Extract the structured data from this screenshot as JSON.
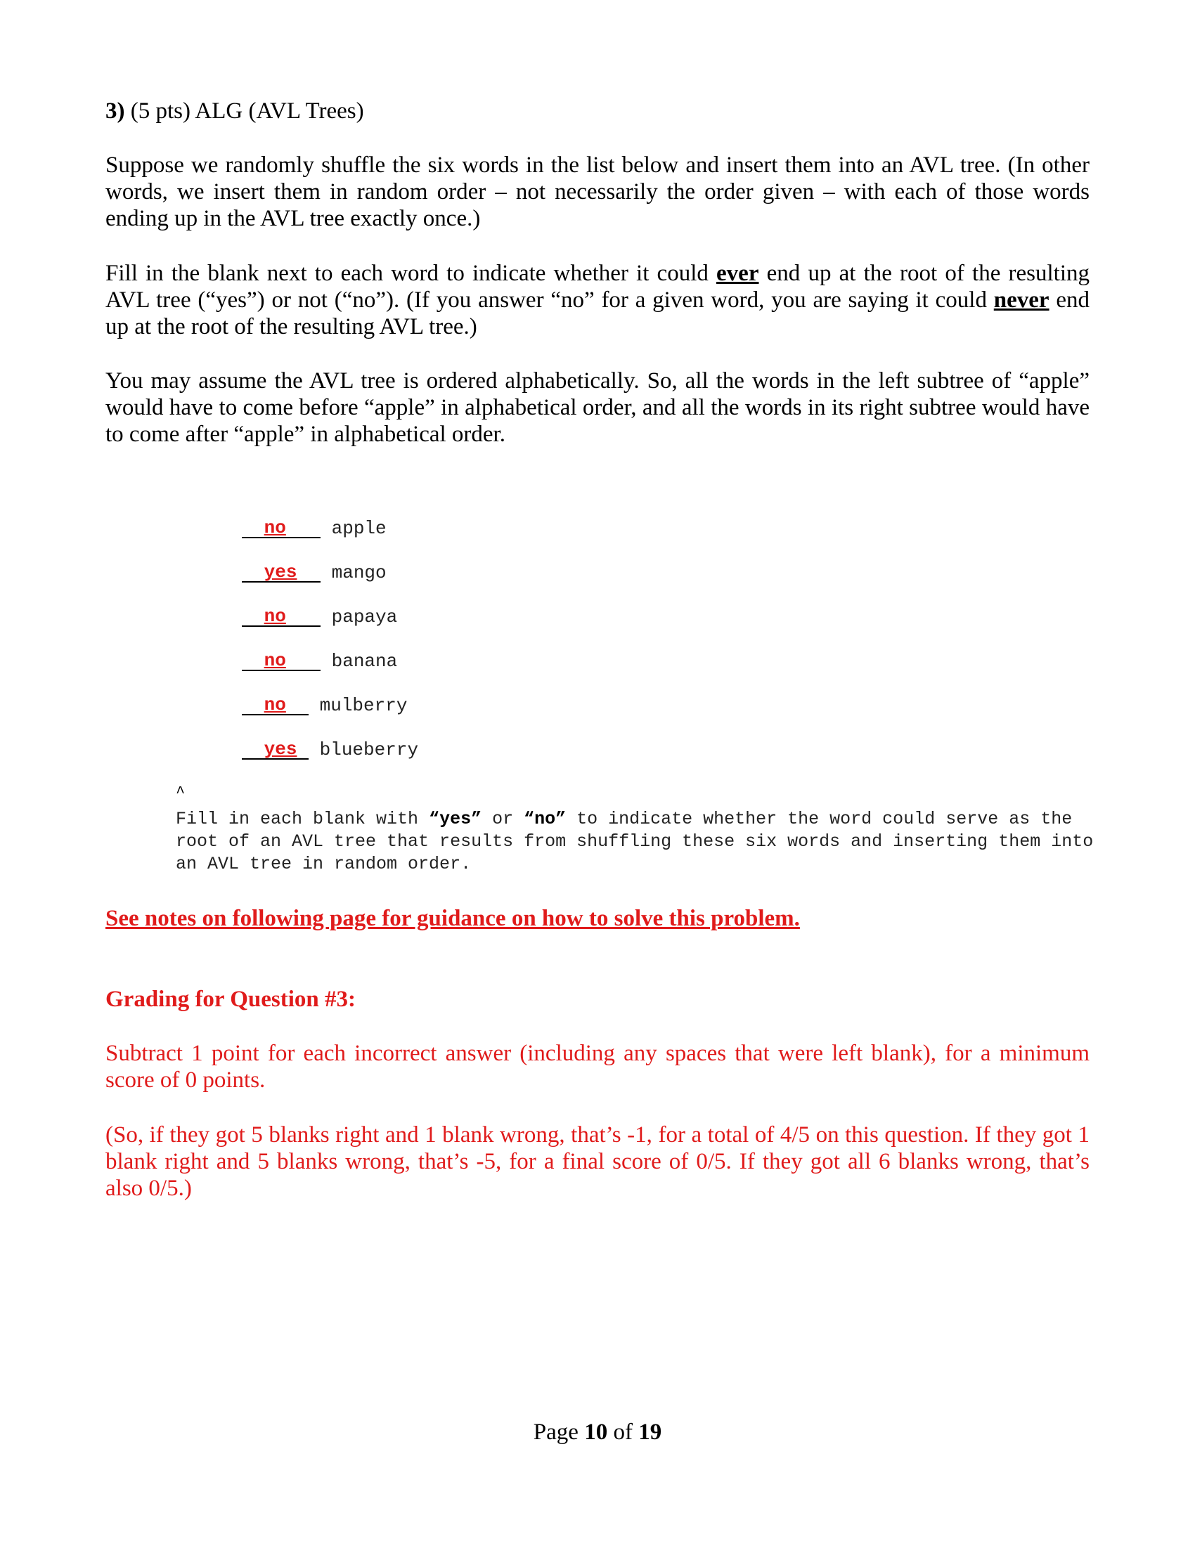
{
  "question": {
    "number": "3)",
    "points": "(5 pts) ALG (AVL Trees)"
  },
  "paragraphs": {
    "p1": "Suppose we randomly shuffle the six words in the list below and insert them into an AVL tree. (In other words, we insert them in random order – not necessarily the order given – with each of those words ending up in the AVL tree exactly once.)",
    "p2_a": "Fill in the blank next to each word to indicate whether it could ",
    "p2_ever": "ever",
    "p2_b": " end up at the root of the resulting AVL tree (“yes”) or not (“no”). (If you answer “no” for a given word, you are saying it could ",
    "p2_never": "never",
    "p2_c": " end up at the root of the resulting AVL tree.)",
    "p3": "You may assume the AVL tree is ordered alphabetically. So, all the words in the left subtree of “apple” would have to come before “apple” in alphabetical order, and all the words in its right subtree would have to come after “apple” in alphabetical order."
  },
  "answers": [
    {
      "answer": "no",
      "word": "apple"
    },
    {
      "answer": "yes",
      "word": "mango"
    },
    {
      "answer": "no",
      "word": "papaya"
    },
    {
      "answer": "no",
      "word": "banana"
    },
    {
      "answer": "no",
      "word": "mulberry"
    },
    {
      "answer": "yes",
      "word": "blueberry"
    }
  ],
  "caret": "^",
  "instructions": {
    "a": "Fill in each blank with ",
    "yes": "“yes”",
    "or": " or ",
    "no": "“no”",
    "b": " to indicate whether the word could serve as the root of an AVL tree that results from shuffling these six words and inserting them into an AVL tree in random order."
  },
  "see_notes": "See notes on following page for guidance on how to solve this problem.",
  "grading": {
    "title": "Grading for Question #3:",
    "g1": "Subtract 1 point for each incorrect answer (including any spaces that were left blank), for a minimum score of 0 points.",
    "g2": "(So, if they got 5 blanks right and 1 blank wrong, that’s -1, for a total of 4/5 on this question. If they got 1 blank right and 5 blanks wrong, that’s -5, for a final score of 0/5. If they got all 6 blanks wrong, that’s also 0/5.)"
  },
  "footer": {
    "prefix": "Page ",
    "current": "10",
    "mid": " of ",
    "total": "19"
  },
  "colors": {
    "answer_red": "#e01b1b"
  }
}
